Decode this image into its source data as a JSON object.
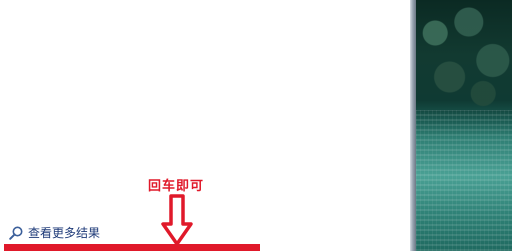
{
  "search": {
    "more_results_label": "查看更多结果",
    "icon": "search-icon"
  },
  "annotation": {
    "text": "回车即可",
    "color": "#e0192a"
  }
}
